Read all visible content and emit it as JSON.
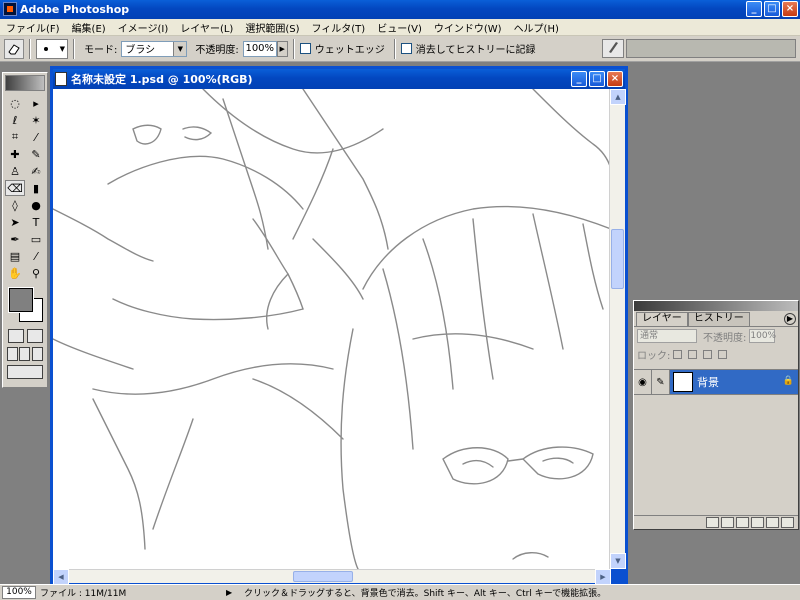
{
  "app": {
    "title": "Adobe Photoshop",
    "window_buttons": [
      "_",
      "□",
      "×"
    ]
  },
  "menu": [
    "ファイル(F)",
    "編集(E)",
    "イメージ(I)",
    "レイヤー(L)",
    "選択範囲(S)",
    "フィルタ(T)",
    "ビュー(V)",
    "ウインドウ(W)",
    "ヘルプ(H)"
  ],
  "options": {
    "mode_label": "モード:",
    "mode_value": "ブラシ",
    "opacity_label": "不透明度:",
    "opacity_value": "100%",
    "wet_edges_label": "ウェットエッジ",
    "erase_history_label": "消去してヒストリーに記録"
  },
  "document": {
    "title": "名称未設定 1.psd @ 100%(RGB)",
    "buttons": [
      "_",
      "□",
      "×"
    ]
  },
  "layers_panel": {
    "tabs": [
      "レイヤー",
      "ヒストリー"
    ],
    "blend_mode": "通常",
    "opacity_label": "不透明度:",
    "opacity_value": "100%",
    "lock_label": "ロック:",
    "layer_name": "背景"
  },
  "status": {
    "zoom": "100%",
    "file_info": "ファイル : 11M/11M",
    "message": "クリック＆ドラッグすると、背景色で消去。Shift キー、Alt キー、Ctrl キーで機能拡張。"
  },
  "colors": {
    "foreground": "#808080",
    "background": "#ffffff",
    "selection": "#316ac5",
    "titlebar": "#0347c0"
  },
  "icons": {
    "options_tool": "eraser-icon",
    "brush_dock": "brush-icon"
  }
}
